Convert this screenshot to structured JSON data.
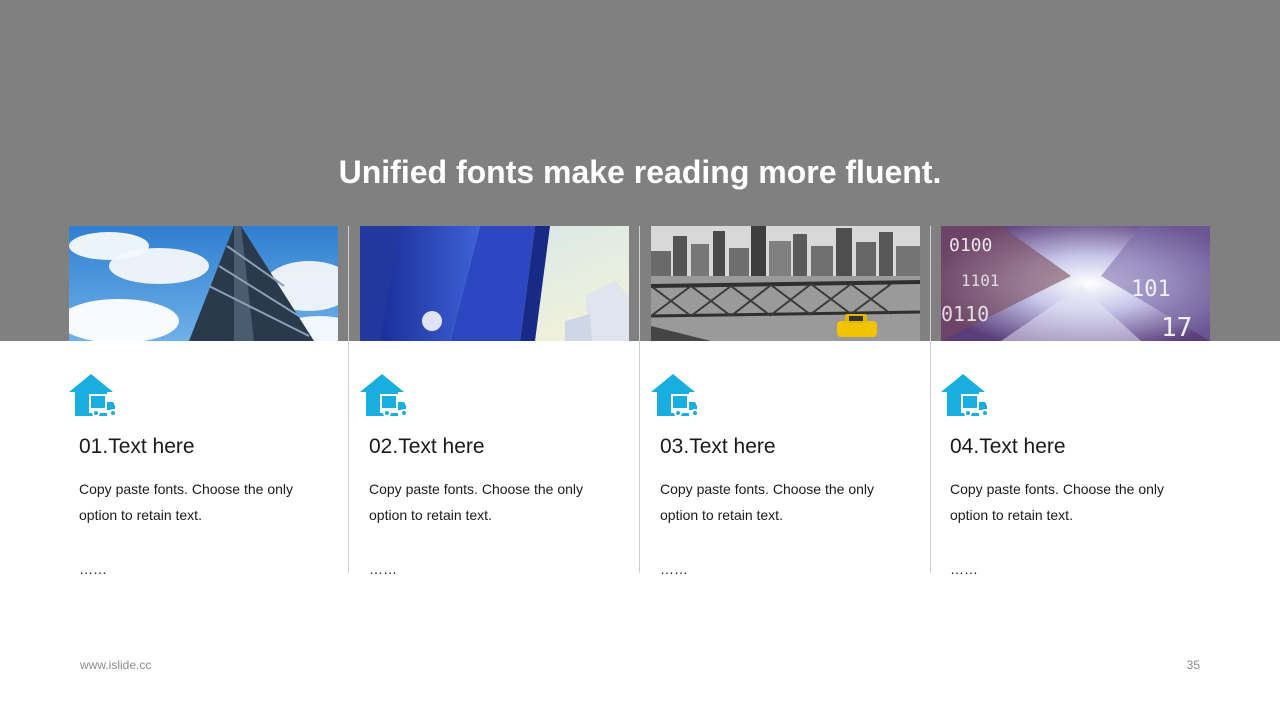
{
  "slide": {
    "title": "Unified fonts make reading more fluent.",
    "footer_url": "www.islide.cc",
    "page_number": "35"
  },
  "theme": {
    "band_color": "#808080",
    "accent_color": "#1AAEE0"
  },
  "cards": [
    {
      "heading": "01.Text here",
      "body": "Copy paste fonts. Choose the only option to retain text.",
      "ellipsis": "……",
      "photo": "glass-tower-blue-sky",
      "icon": "warehouse-truck-icon"
    },
    {
      "heading": "02.Text here",
      "body": "Copy paste fonts. Choose the only option to retain text.",
      "ellipsis": "……",
      "photo": "blue-skyscrapers-sun",
      "icon": "warehouse-truck-icon"
    },
    {
      "heading": "03.Text here",
      "body": "Copy paste fonts. Choose the only option to retain text.",
      "ellipsis": "……",
      "photo": "bridge-city-yellow-taxi",
      "icon": "warehouse-truck-icon"
    },
    {
      "heading": "04.Text here",
      "body": "Copy paste fonts. Choose the only option to retain text.",
      "ellipsis": "……",
      "photo": "digital-binary-tunnel",
      "icon": "warehouse-truck-icon"
    }
  ]
}
